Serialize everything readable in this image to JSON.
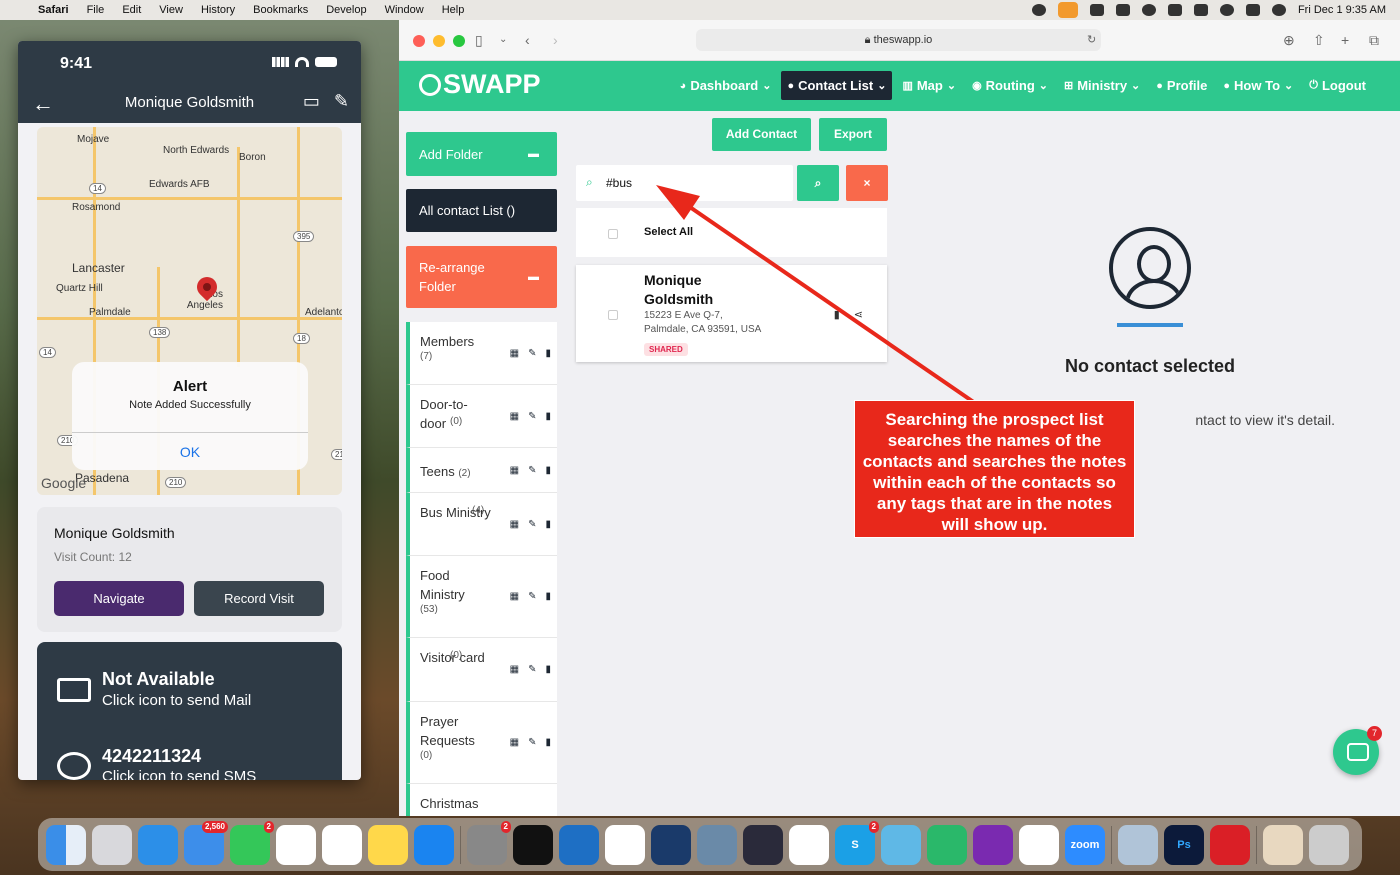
{
  "menubar": {
    "app": "Safari",
    "items": [
      "File",
      "Edit",
      "View",
      "History",
      "Bookmarks",
      "Develop",
      "Window",
      "Help"
    ],
    "datetime": "Fri Dec 1  9:35 AM"
  },
  "phone": {
    "time": "9:41",
    "title": "Monique Goldsmith",
    "map_labels": [
      "Mojave",
      "North Edwards",
      "Boron",
      "Edwards AFB",
      "Rosamond",
      "Lancaster",
      "Quartz Hill",
      "Palmdale",
      "Los Angeles",
      "Adelanto",
      "Pasadena"
    ],
    "map_shields": [
      "14",
      "395",
      "138",
      "18",
      "14",
      "210",
      "21",
      "210"
    ],
    "google": "Google",
    "alert": {
      "title": "Alert",
      "message": "Note Added Successfully",
      "ok": "OK"
    },
    "card": {
      "name": "Monique Goldsmith",
      "visits": "Visit Count: 12",
      "navigate": "Navigate",
      "record": "Record Visit"
    },
    "mail": {
      "title": "Not Available",
      "sub": "Click icon to send Mail"
    },
    "sms": {
      "title": "4242211324",
      "sub": "Click icon to send SMS"
    }
  },
  "browser": {
    "url": "theswapp.io",
    "logo": "SWAPP",
    "nav": [
      {
        "label": "Dashboard",
        "icon": "dashboard-icon",
        "dropdown": true
      },
      {
        "label": "Contact List",
        "icon": "user-circle-icon",
        "dropdown": true,
        "active": true
      },
      {
        "label": "Map",
        "icon": "map-icon",
        "dropdown": true
      },
      {
        "label": "Routing",
        "icon": "location-icon",
        "dropdown": true
      },
      {
        "label": "Ministry",
        "icon": "sitemap-icon",
        "dropdown": true
      },
      {
        "label": "Profile",
        "icon": "user-icon",
        "dropdown": false
      },
      {
        "label": "How To",
        "icon": "lightbulb-icon",
        "dropdown": true
      },
      {
        "label": "Logout",
        "icon": "power-icon",
        "dropdown": false
      }
    ],
    "sidebar": {
      "add_folder": "Add Folder",
      "all_contacts": "All contact List ()",
      "rearrange": "Re-arrange Folder",
      "folders": [
        {
          "name": "Members",
          "count": "(7)"
        },
        {
          "name": "Door-to-door",
          "count": "(0)"
        },
        {
          "name": "Teens",
          "count": "(2)"
        },
        {
          "name": "Bus Ministry",
          "count": "(4)"
        },
        {
          "name": "Food Ministry",
          "count": "(53)"
        },
        {
          "name": "Visitor card",
          "count": "(0)"
        },
        {
          "name": "Prayer Requests",
          "count": "(0)"
        },
        {
          "name": "Christmas",
          "count": ""
        }
      ]
    },
    "main": {
      "add_contact": "Add Contact",
      "export": "Export",
      "search_value": "#bus",
      "select_all": "Select All",
      "contact": {
        "name": "Monique Goldsmith",
        "address1": "15223 E Ave Q-7,",
        "address2": "Palmdale, CA 93591, USA",
        "badge": "SHARED"
      }
    },
    "detail": {
      "title": "No contact selected",
      "sub": "ntact to view it's detail."
    },
    "chat_badge": "7"
  },
  "callout": "Searching the prospect list searches the names of the contacts and searches the notes within each of the contacts so any tags that are in the notes will show up.",
  "colors": {
    "accent": "#2ec88e",
    "dark": "#1d2733",
    "orange": "#f9694b",
    "callout": "#e8281b"
  },
  "dock": {
    "badges": {
      "mail": "2,560",
      "messages": "2",
      "settings": "2",
      "skype": "2"
    },
    "zoom_label": "zoom",
    "ps_label": "Ps",
    "skype_label": "S"
  }
}
